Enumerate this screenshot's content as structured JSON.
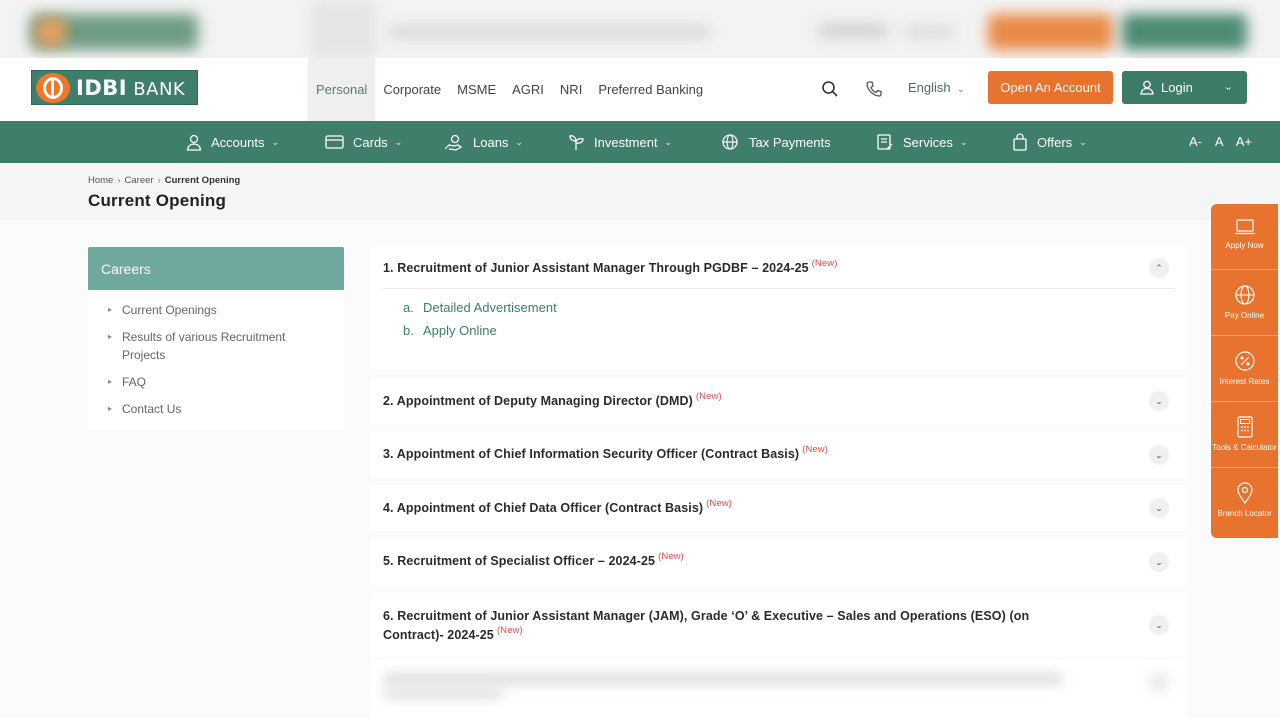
{
  "brand": {
    "logo_text_bold": "IDBI",
    "logo_text_rest": " BANK"
  },
  "segments": [
    "Personal",
    "Corporate",
    "MSME",
    "AGRI",
    "NRI",
    "Preferred Banking"
  ],
  "header": {
    "language": "English",
    "open_account": "Open An Account",
    "login": "Login"
  },
  "mainnav": {
    "items": [
      "Accounts",
      "Cards",
      "Loans",
      "Investment",
      "Tax Payments",
      "Services",
      "Offers"
    ],
    "font_controls": "A- A A+"
  },
  "breadcrumb": {
    "home": "Home",
    "career": "Career",
    "current": "Current Opening"
  },
  "page_title": "Current Opening",
  "sidebar": {
    "title": "Careers",
    "items": [
      "Current Openings",
      "Results of various Recruitment Projects",
      "FAQ",
      "Contact Us"
    ]
  },
  "openings": [
    {
      "title": "1. Recruitment of Junior Assistant Manager Through PGDBF – 2024-25",
      "badge": "(New)"
    },
    {
      "title": "2. Appointment of Deputy Managing Director (DMD)",
      "badge": "(New)"
    },
    {
      "title": "3. Appointment of Chief Information Security Officer (Contract Basis)",
      "badge": "(New)"
    },
    {
      "title": "4. Appointment of Chief Data Officer (Contract Basis)",
      "badge": "(New)"
    },
    {
      "title": "5. Recruitment of Specialist Officer – 2024-25",
      "badge": "(New)"
    },
    {
      "title": "6. Recruitment of Junior Assistant Manager (JAM), Grade ‘O’ & Executive – Sales and Operations (ESO) (on Contract)- 2024-25",
      "badge": "(New)"
    }
  ],
  "expanded_links": [
    {
      "marker": "a.",
      "label": "Detailed Advertisement"
    },
    {
      "marker": "b.",
      "label": "Apply Online"
    }
  ],
  "rail": [
    "Apply Now",
    "Pay Online",
    "Interest Rates",
    "Tools & Calculator",
    "Branch Locator"
  ],
  "colors": {
    "brand_green": "#3f7e6b",
    "brand_orange": "#e8732f",
    "sidebar_header": "#6ea89f",
    "new_badge": "#d94f4f"
  }
}
